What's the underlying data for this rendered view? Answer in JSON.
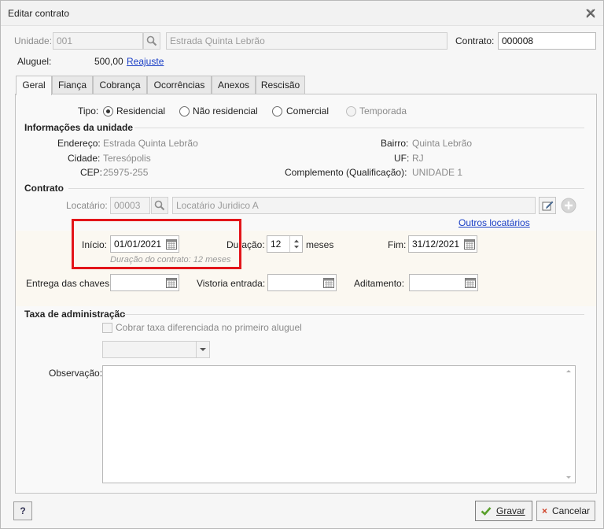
{
  "window": {
    "title": "Editar contrato"
  },
  "header": {
    "unidade_label": "Unidade:",
    "unidade_code": "001",
    "unidade_name": "Estrada Quinta Lebrão",
    "contrato_label": "Contrato:",
    "contrato_value": "000008",
    "aluguel_label": "Aluguel:",
    "aluguel_value": "500,00",
    "reajuste_link": "Reajuste"
  },
  "tabs": [
    "Geral",
    "Fiança",
    "Cobrança",
    "Ocorrências",
    "Anexos",
    "Rescisão"
  ],
  "tipo": {
    "label": "Tipo:",
    "options": [
      "Residencial",
      "Não residencial",
      "Comercial",
      "Temporada"
    ],
    "selected": "Residencial"
  },
  "unit_info": {
    "section_title": "Informações da unidade",
    "endereco_label": "Endereço:",
    "endereco_value": "Estrada Quinta Lebrão",
    "cidade_label": "Cidade:",
    "cidade_value": "Teresópolis",
    "cep_label": "CEP:",
    "cep_value": "25975-255",
    "bairro_label": "Bairro:",
    "bairro_value": "Quinta Lebrão",
    "uf_label": "UF:",
    "uf_value": "RJ",
    "complemento_label": "Complemento (Qualificação):",
    "complemento_value": "UNIDADE 1"
  },
  "contrato": {
    "section_title": "Contrato",
    "locatario_label": "Locatário:",
    "locatario_code": "00003",
    "locatario_name": "Locatário Juridico A",
    "outros_link": "Outros locatários",
    "inicio_label": "Início:",
    "inicio_value": "01/01/2021",
    "duracao_label": "Duração:",
    "duracao_value": "12",
    "meses_label": "meses",
    "fim_label": "Fim:",
    "fim_value": "31/12/2021",
    "duracao_hint": "Duração do contrato: 12 meses",
    "entrega_label": "Entrega das chaves:",
    "entrega_value": "",
    "vistoria_label": "Vistoria entrada:",
    "vistoria_value": "",
    "aditamento_label": "Aditamento:",
    "aditamento_value": ""
  },
  "taxa": {
    "section_title": "Taxa de administração",
    "checkbox_label": "Cobrar taxa diferenciada no primeiro aluguel",
    "select_value": ""
  },
  "observacao": {
    "label": "Observação:",
    "value": ""
  },
  "footer": {
    "help_label": "?",
    "save_label": "Gravar",
    "cancel_label": "Cancelar"
  }
}
